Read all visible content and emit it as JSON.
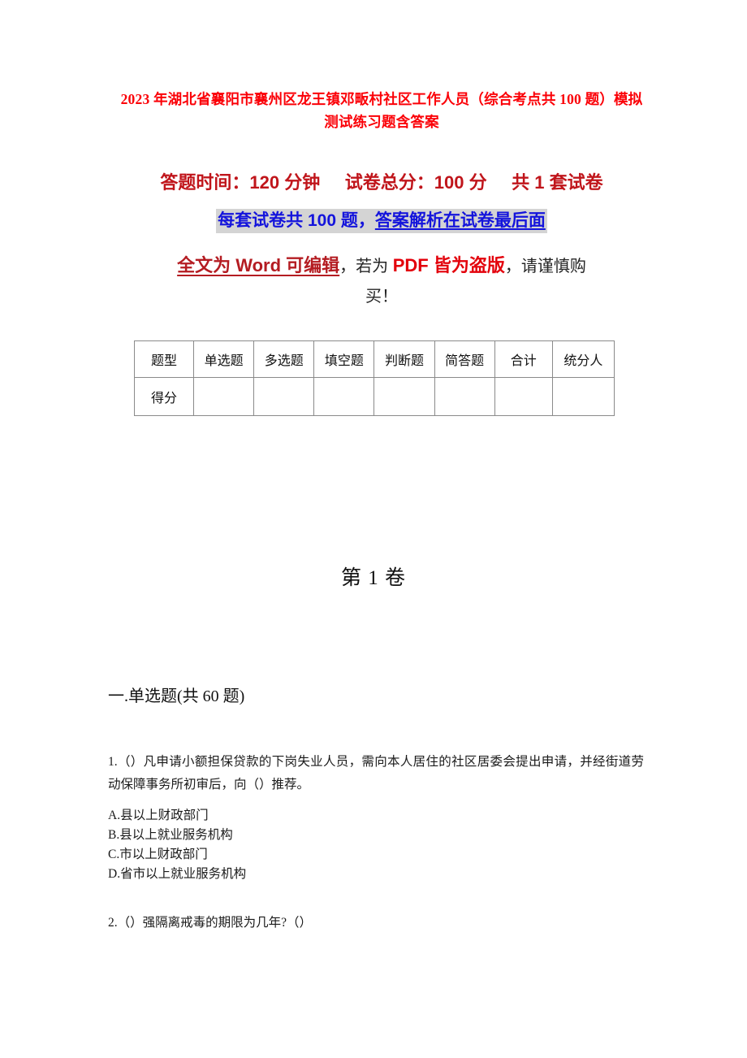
{
  "document": {
    "title": "2023 年湖北省襄阳市襄州区龙王镇邓畈村社区工作人员（综合考点共 100 题）模拟测试练习题含答案",
    "title_color": "#fb0007"
  },
  "meta": {
    "line1": "答题时间：120 分钟     试卷总分：100 分     共 1 套试卷",
    "line1_color": "#c0151b",
    "line2_prefix": "每套试卷共 100 题，",
    "line2_underlined": "答案解析在试卷最后面",
    "line2_color": "#1414dc",
    "line2_highlight_color": "#d4d4d4",
    "line3_word": "全文为 Word 可编辑",
    "line3_sep1": "，若为 ",
    "line3_pdf": "PDF 皆为盗版",
    "line3_sep2": "，请谨慎购",
    "line4": "买！",
    "word_color": "#b41c22",
    "pdf_color": "#e3000b"
  },
  "score_table": {
    "headers": [
      "题型",
      "单选题",
      "多选题",
      "填空题",
      "判断题",
      "简答题",
      "合计",
      "统分人"
    ],
    "row_label": "得分",
    "row_values": [
      "",
      "",
      "",
      "",
      "",
      "",
      ""
    ]
  },
  "volume": {
    "heading": "第 1 卷"
  },
  "section": {
    "heading": "一.单选题(共 60 题)"
  },
  "questions": [
    {
      "stem": "1.（）凡申请小额担保贷款的下岗失业人员，需向本人居住的社区居委会提出申请，并经街道劳动保障事务所初审后，向（）推荐。",
      "options": [
        "A.县以上财政部门",
        "B.县以上就业服务机构",
        "C.市以上财政部门",
        "D.省市以上就业服务机构"
      ]
    },
    {
      "stem": "2.（）强隔离戒毒的期限为几年?（）",
      "options": []
    }
  ]
}
